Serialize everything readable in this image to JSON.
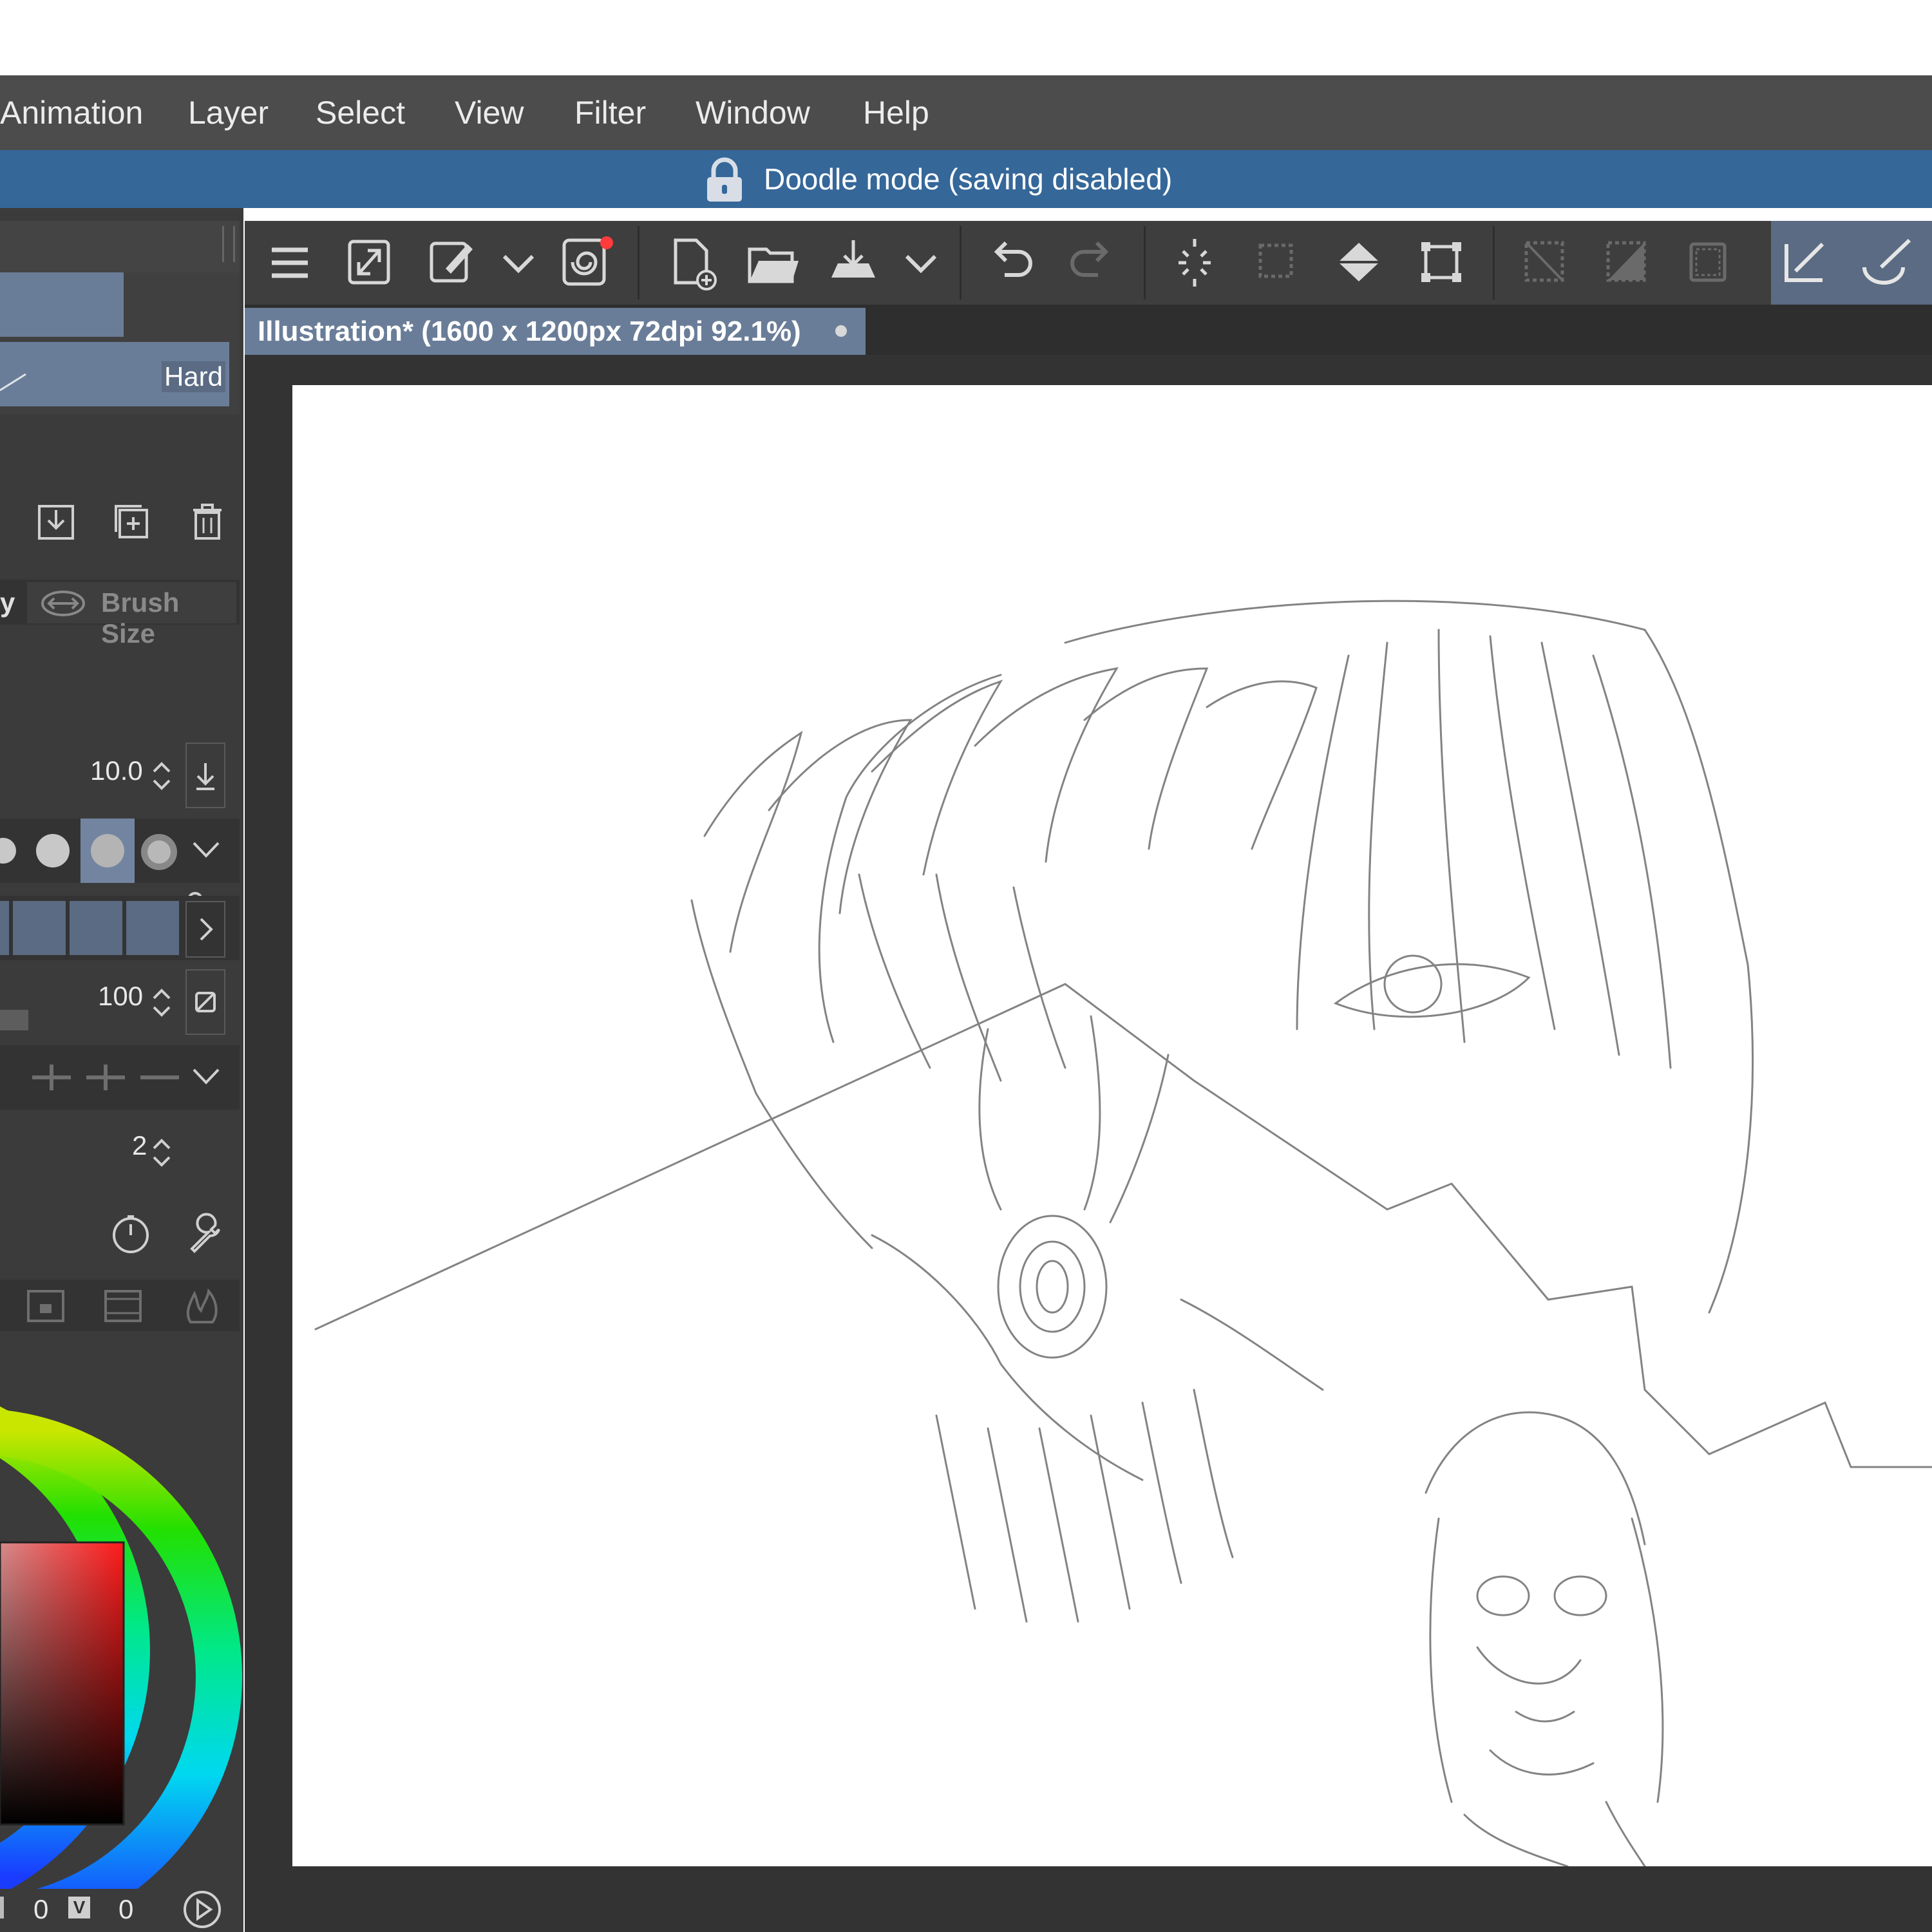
{
  "menu": {
    "items": [
      "Animation",
      "Layer",
      "Select",
      "View",
      "Filter",
      "Window",
      "Help"
    ]
  },
  "notice": {
    "text": "Doodle mode (saving disabled)",
    "icon": "lock-icon",
    "color": "#356799"
  },
  "document_tab": {
    "title": "Illustration* (1600 x 1200px 72dpi 92.1%)"
  },
  "brush_panel": {
    "preset_label": "Hard",
    "tab_partial": "y",
    "tab_brush_size": "Brush Size",
    "size_value": "10.0",
    "opacity_value": "100",
    "spacing_value": "2"
  },
  "color_panel": {
    "value_a": "0",
    "value_b": "0",
    "badge": "V"
  },
  "colors": {
    "menubar": "#4c4c4c",
    "panel": "#3b3b3b",
    "accent": "#6a7d98",
    "notice": "#356799"
  }
}
